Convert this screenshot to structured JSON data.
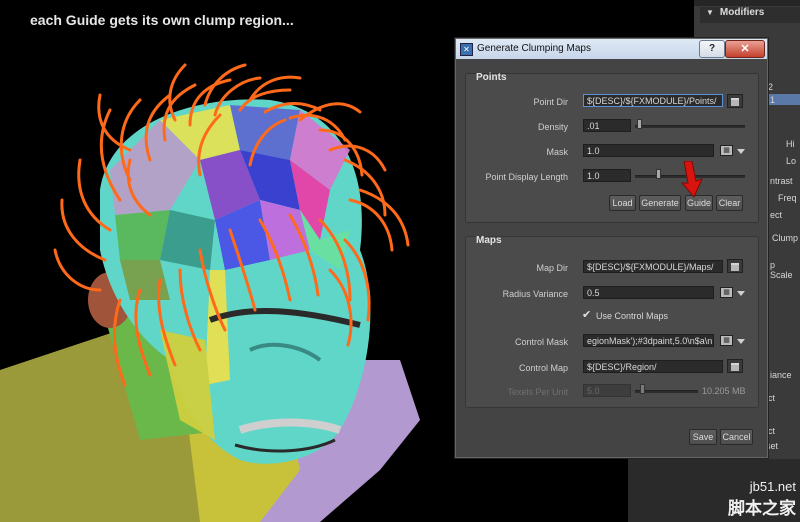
{
  "caption": "each Guide gets its own clump region...",
  "background_panel": {
    "top_label": "Modifiers",
    "labels": [
      "2",
      "1",
      "Hi",
      "Lo",
      "ntrast",
      "Freq",
      "ect",
      "Clump",
      "p Scale",
      "iance",
      "ct",
      "ct",
      "set"
    ]
  },
  "dialog": {
    "title": "Generate Clumping Maps",
    "help": "?",
    "close": "✕",
    "points": {
      "title": "Points",
      "point_dir_label": "Point Dir",
      "point_dir_value": "${DESC}/${FXMODULE}/Points/",
      "density_label": "Density",
      "density_value": ".01",
      "density_level": 0.02,
      "mask_label": "Mask",
      "mask_value": "1.0",
      "display_length_label": "Point Display Length",
      "display_length_value": "1.0",
      "display_length_level": 0.2,
      "buttons": {
        "load": "Load",
        "generate": "Generate",
        "guide": "Guide",
        "clear": "Clear"
      }
    },
    "maps": {
      "title": "Maps",
      "map_dir_label": "Map Dir",
      "map_dir_value": "${DESC}/${FXMODULE}/Maps/",
      "radius_variance_label": "Radius Variance",
      "radius_variance_value": "0.5",
      "use_control_maps_label": "Use Control Maps",
      "use_control_maps_checked": true,
      "control_mask_label": "Control Mask",
      "control_mask_value": "egionMask');#3dpaint,5.0\\n$a\\n",
      "control_map_label": "Control Map",
      "control_map_value": "${DESC}/Region/",
      "texels_label": "Texels Per Unit",
      "texels_value": "5.0",
      "texels_size": "10.205 MB"
    },
    "save": "Save",
    "cancel": "Cancel"
  },
  "watermark": {
    "url": "jb51.net",
    "cn": "脚本之家"
  },
  "colors": {
    "hair": "#ff6a1a",
    "arrow": "#d8140e",
    "skin": "#5fd6c8",
    "dialog_bg": "#444444"
  }
}
